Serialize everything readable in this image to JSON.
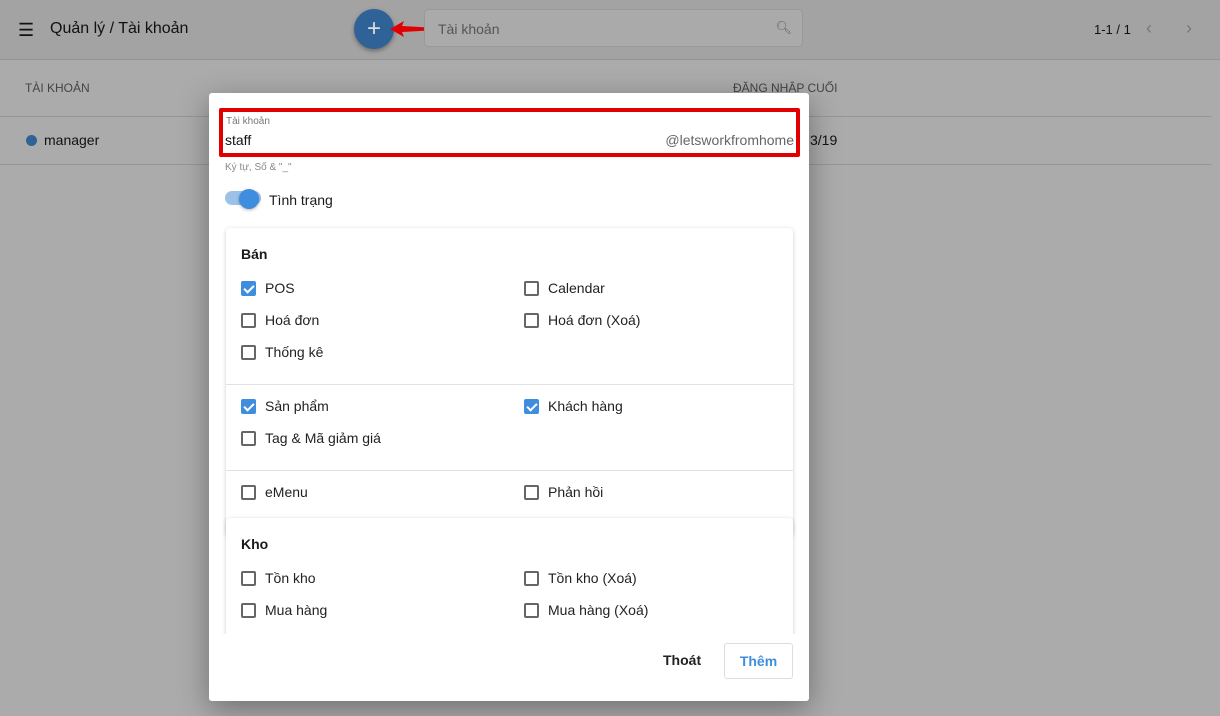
{
  "header": {
    "title": "Quản lý / Tài khoản",
    "search_placeholder": "Tài khoản",
    "pagination": "1-1 / 1"
  },
  "table": {
    "columns": [
      "TÀI KHOẢN",
      "ĐĂNG NHẬP CUỐI"
    ],
    "rows": [
      {
        "account": "manager",
        "last_login": "3/19"
      }
    ]
  },
  "colors": {
    "accent": "#3f8dde",
    "highlight": "#e00000"
  },
  "modal": {
    "field_label": "Tài khoản",
    "field_value": "staff",
    "field_suffix": "@letsworkfromhome",
    "field_hint": "Ký tự, Số & \"_\"",
    "status_label": "Tình trạng",
    "status_on": true,
    "sections": [
      {
        "title": "Bán",
        "groups": [
          [
            {
              "label": "POS",
              "checked": true
            },
            {
              "label": "Calendar",
              "checked": false
            },
            {
              "label": "Hoá đơn",
              "checked": false
            },
            {
              "label": "Hoá đơn (Xoá)",
              "checked": false
            },
            {
              "label": "Thống kê",
              "checked": false
            }
          ],
          [
            {
              "label": "Sản phẩm",
              "checked": true
            },
            {
              "label": "Khách hàng",
              "checked": true
            },
            {
              "label": "Tag & Mã giảm giá",
              "checked": false
            }
          ],
          [
            {
              "label": "eMenu",
              "checked": false
            },
            {
              "label": "Phản hồi",
              "checked": false
            }
          ]
        ]
      },
      {
        "title": "Kho",
        "groups": [
          [
            {
              "label": "Tồn kho",
              "checked": false
            },
            {
              "label": "Tồn kho (Xoá)",
              "checked": false
            },
            {
              "label": "Mua hàng",
              "checked": false
            },
            {
              "label": "Mua hàng (Xoá)",
              "checked": false
            }
          ]
        ]
      }
    ],
    "cancel_label": "Thoát",
    "submit_label": "Thêm"
  }
}
